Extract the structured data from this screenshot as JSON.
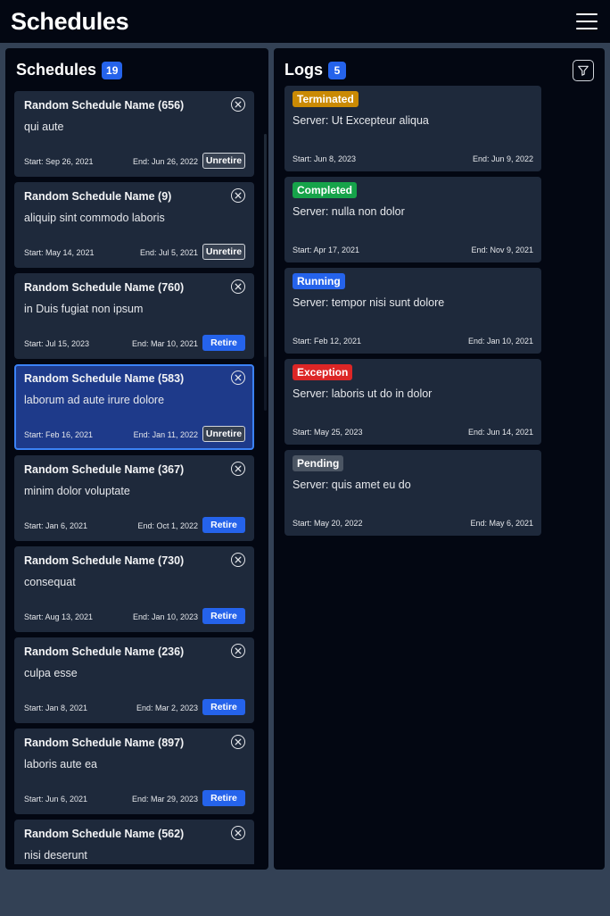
{
  "app": {
    "title": "Schedules"
  },
  "colors": {
    "accent": "#2563eb",
    "background": "#030712",
    "card": "#1e293b",
    "selected_card": "#1e3a8a",
    "status_terminated": "#ca8a04",
    "status_completed": "#16a34a",
    "status_running": "#2563eb",
    "status_exception": "#dc2626",
    "status_pending": "#4b5563"
  },
  "icons": {
    "menu": "hamburger-icon",
    "filter": "funnel-icon",
    "remove": "x-circle-icon"
  },
  "schedules": {
    "title": "Schedules",
    "count": "19",
    "items": [
      {
        "name": "Random Schedule Name (656)",
        "description": "qui aute",
        "start": "Start: Sep 26, 2021",
        "end": "End: Jun 26, 2022",
        "action": "Unretire",
        "selected": false
      },
      {
        "name": "Random Schedule Name (9)",
        "description": "aliquip sint commodo laboris",
        "start": "Start: May 14, 2021",
        "end": "End: Jul 5, 2021",
        "action": "Unretire",
        "selected": false
      },
      {
        "name": "Random Schedule Name (760)",
        "description": "in Duis fugiat non ipsum",
        "start": "Start: Jul 15, 2023",
        "end": "End: Mar 10, 2021",
        "action": "Retire",
        "selected": false
      },
      {
        "name": "Random Schedule Name (583)",
        "description": "laborum ad aute irure dolore",
        "start": "Start: Feb 16, 2021",
        "end": "End: Jan 11, 2022",
        "action": "Unretire",
        "selected": true
      },
      {
        "name": "Random Schedule Name (367)",
        "description": "minim dolor voluptate",
        "start": "Start: Jan 6, 2021",
        "end": "End: Oct 1, 2022",
        "action": "Retire",
        "selected": false
      },
      {
        "name": "Random Schedule Name (730)",
        "description": "consequat",
        "start": "Start: Aug 13, 2021",
        "end": "End: Jan 10, 2023",
        "action": "Retire",
        "selected": false
      },
      {
        "name": "Random Schedule Name (236)",
        "description": "culpa esse",
        "start": "Start: Jan 8, 2021",
        "end": "End: Mar 2, 2023",
        "action": "Retire",
        "selected": false
      },
      {
        "name": "Random Schedule Name (897)",
        "description": "laboris aute ea",
        "start": "Start: Jun 6, 2021",
        "end": "End: Mar 29, 2023",
        "action": "Retire",
        "selected": false
      },
      {
        "name": "Random Schedule Name (562)",
        "description": "nisi deserunt",
        "start": "",
        "end": "",
        "action": "",
        "selected": false
      }
    ]
  },
  "logs": {
    "title": "Logs",
    "count": "5",
    "items": [
      {
        "status": "Terminated",
        "status_key": "status_terminated",
        "server": "Server: Ut Excepteur aliqua",
        "start": "Start: Jun 8, 2023",
        "end": "End: Jun 9, 2022"
      },
      {
        "status": "Completed",
        "status_key": "status_completed",
        "server": "Server: nulla non dolor",
        "start": "Start: Apr 17, 2021",
        "end": "End: Nov 9, 2021"
      },
      {
        "status": "Running",
        "status_key": "status_running",
        "server": "Server: tempor nisi sunt dolore",
        "start": "Start: Feb 12, 2021",
        "end": "End: Jan 10, 2021"
      },
      {
        "status": "Exception",
        "status_key": "status_exception",
        "server": "Server: laboris ut do in dolor",
        "start": "Start: May 25, 2023",
        "end": "End: Jun 14, 2021"
      },
      {
        "status": "Pending",
        "status_key": "status_pending",
        "server": "Server: quis amet eu do",
        "start": "Start: May 20, 2022",
        "end": "End: May 6, 2021"
      }
    ]
  }
}
